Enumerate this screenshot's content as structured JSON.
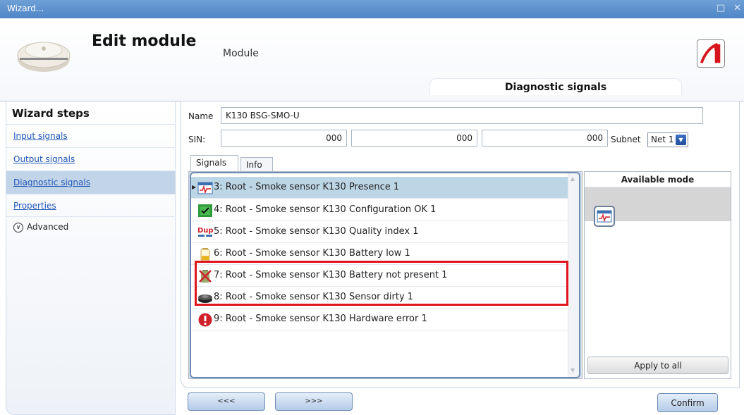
{
  "window": {
    "title": "Wizard..."
  },
  "header": {
    "title": "Edit module",
    "subtitle": "Module",
    "active_tab": "Diagnostic signals"
  },
  "sidebar": {
    "title": "Wizard steps",
    "items": [
      {
        "label": "Input signals"
      },
      {
        "label": "Output signals"
      },
      {
        "label": "Diagnostic signals",
        "selected": true
      },
      {
        "label": "Properties"
      }
    ],
    "advanced_label": "Advanced"
  },
  "form": {
    "name_label": "Name",
    "name_value": "K130 BSG-SMO-U",
    "sin_label": "SIN:",
    "sin_values": [
      "000",
      "000",
      "000"
    ],
    "subnet_label": "Subnet",
    "subnet_value": "Net 1"
  },
  "tabs": [
    "Signals",
    "Info"
  ],
  "signals": [
    {
      "label": "3: Root - Smoke sensor K130 Presence 1",
      "icon": "presence-icon",
      "selected": true
    },
    {
      "label": "4: Root - Smoke sensor K130 Configuration OK 1",
      "icon": "configuration-ok-icon"
    },
    {
      "label": "5: Root - Smoke sensor K130 Quality index 1",
      "icon": "quality-index-icon"
    },
    {
      "label": "6: Root - Smoke sensor K130 Battery low 1",
      "icon": "battery-low-icon"
    },
    {
      "label": "7: Root - Smoke sensor K130 Battery not present 1",
      "icon": "battery-not-present-icon"
    },
    {
      "label": "8: Root - Smoke sensor K130 Sensor dirty 1",
      "icon": "sensor-dirty-icon"
    },
    {
      "label": "9: Root - Smoke sensor K130 Hardware error 1",
      "icon": "hardware-error-icon"
    }
  ],
  "available_mode": {
    "title": "Available mode",
    "apply_label": "Apply to all"
  },
  "buttons": {
    "prev": "<<<",
    "next": ">>>",
    "confirm": "Confirm"
  },
  "colors": {
    "accent": "#4f86c6",
    "selection": "#bdd6e6",
    "highlight_box": "#e0151b"
  }
}
